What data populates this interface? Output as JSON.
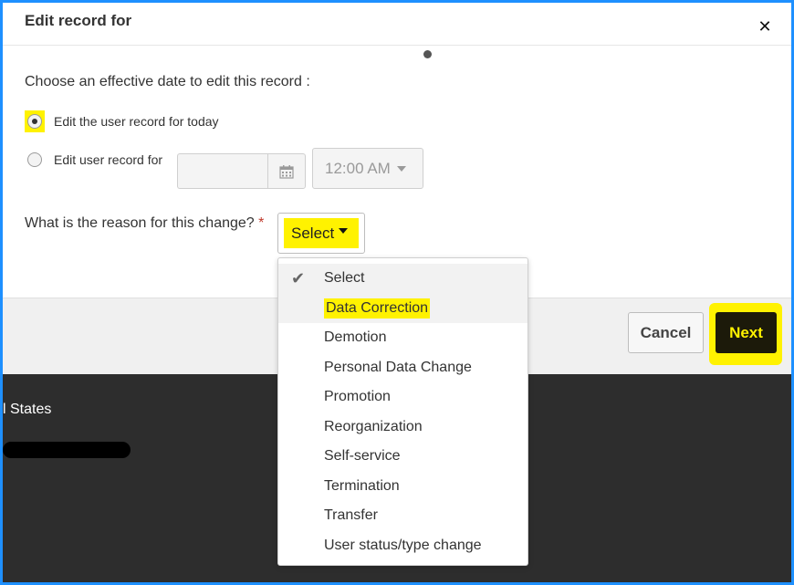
{
  "background": {
    "partial_text": "l States"
  },
  "dialog": {
    "title": "Edit record for",
    "close_glyph": "✕",
    "choose_label": "Choose an effective date to edit this record :",
    "radio_today_label": "Edit the user record for today",
    "radio_custom_label": "Edit user record for",
    "date_value": "",
    "time_value": "12:00 AM",
    "reason_label": "What is the reason for this change?",
    "required_marker": "*",
    "reason_selected": "Select",
    "cancel_label": "Cancel",
    "next_label": "Next"
  },
  "dropdown": {
    "items": [
      "Select",
      "Data Correction",
      "Demotion",
      "Personal Data Change",
      "Promotion",
      "Reorganization",
      "Self-service",
      "Termination",
      "Transfer",
      "User status/type change"
    ],
    "checked_item": "Select",
    "highlighted_item": "Data Correction"
  },
  "colors": {
    "highlight": "#fff200",
    "frame": "#1e90ff",
    "next_bg": "#1c1a0a"
  },
  "icons": [
    "close-icon",
    "calendar-icon",
    "caret-down-icon",
    "checkmark-icon"
  ]
}
